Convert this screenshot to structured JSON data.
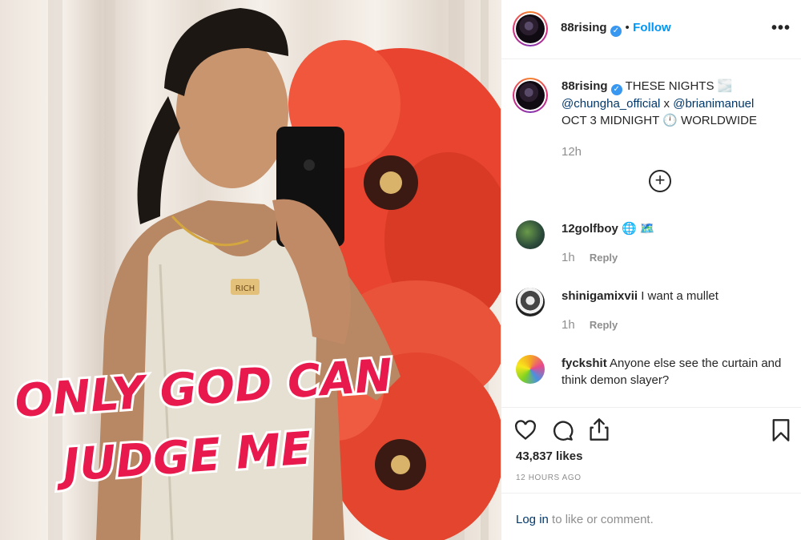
{
  "post": {
    "username": "88rising",
    "verified_mark": "✓",
    "separator": "•",
    "follow_label": "Follow",
    "more_icon": "more-horizontal-icon"
  },
  "image": {
    "overlay_text_line1": "ONLY GOD CAN",
    "overlay_text_line2": "JUDGE ME",
    "necklace_text": "RICH"
  },
  "caption": {
    "username": "88rising",
    "text_part1": "THESE NIGHTS 🌫️",
    "mention1": "@chungha_official",
    "x_text": " x ",
    "mention2": "@brianimanuel",
    "text_part2": "OCT 3 MIDNIGHT 🕛  WORLDWIDE",
    "time": "12h"
  },
  "load_more_icon": "plus-circle-icon",
  "comments": [
    {
      "username": "12golfboy",
      "text": "🌐 🗺️",
      "time": "1h",
      "reply": "Reply"
    },
    {
      "username": "shinigamixvii",
      "text": "I want a mullet",
      "time": "1h",
      "reply": "Reply"
    },
    {
      "username": "fyckshit",
      "text": "Anyone else see the curtain and think demon slayer?"
    }
  ],
  "actions": {
    "likes": "43,837 likes",
    "timestamp": "12 HOURS AGO"
  },
  "login": {
    "link": "Log in",
    "rest": " to like or comment."
  },
  "colors": {
    "accent": "#0095f6",
    "mention": "#00376b",
    "muted": "#8e8e8e",
    "verified": "#3897f0"
  }
}
